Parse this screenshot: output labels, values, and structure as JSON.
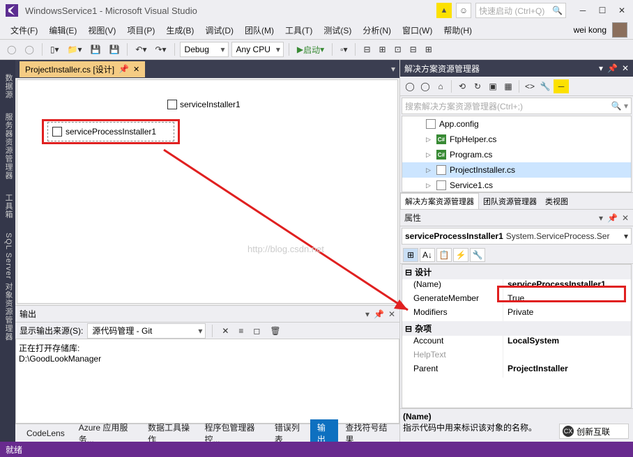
{
  "title": "WindowsService1 - Microsoft Visual Studio",
  "quickLaunch": "快速启动 (Ctrl+Q)",
  "user": "wei kong",
  "menu": [
    "文件(F)",
    "编辑(E)",
    "视图(V)",
    "项目(P)",
    "生成(B)",
    "调试(D)",
    "团队(M)",
    "工具(T)",
    "测试(S)",
    "分析(N)",
    "窗口(W)",
    "帮助(H)"
  ],
  "toolbar": {
    "config": "Debug",
    "platform": "Any CPU",
    "start": "启动"
  },
  "leftTabs": [
    "数据源",
    "服务器资源管理器",
    "工具箱",
    "SQL Server 对象资源管理器"
  ],
  "designer": {
    "tab": "ProjectInstaller.cs [设计]",
    "item1": "serviceInstaller1",
    "item2": "serviceProcessInstaller1"
  },
  "watermark": "http://blog.csdn.net",
  "output": {
    "title": "输出",
    "sourceLabel": "显示输出来源(S):",
    "source": "源代码管理 - Git",
    "line1": "正在打开存储库:",
    "line2": "D:\\GoodLookManager"
  },
  "bottomTabs": [
    "CodeLens",
    "Azure 应用服务...",
    "数据工具操作",
    "程序包管理器控...",
    "错误列表",
    "输出",
    "查找符号结果"
  ],
  "solution": {
    "title": "解决方案资源管理器",
    "searchPh": "搜索解决方案资源管理器(Ctrl+;)",
    "files": [
      "App.config",
      "FtpHelper.cs",
      "Program.cs",
      "ProjectInstaller.cs",
      "Service1.cs"
    ],
    "tabs": [
      "解决方案资源管理器",
      "团队资源管理器",
      "类视图"
    ]
  },
  "props": {
    "title": "属性",
    "target": "serviceProcessInstaller1",
    "targetType": "System.ServiceProcess.Ser",
    "cat1": "设计",
    "name": "(Name)",
    "nameVal": "serviceProcessInstaller1",
    "gen": "GenerateMember",
    "genVal": "True",
    "mod": "Modifiers",
    "modVal": "Private",
    "cat2": "杂项",
    "acc": "Account",
    "accVal": "LocalSystem",
    "help": "HelpText",
    "parent": "Parent",
    "parentVal": "ProjectInstaller",
    "descTitle": "(Name)",
    "desc": "指示代码中用来标识该对象的名称。"
  },
  "status": "就绪",
  "logo": "创新互联"
}
